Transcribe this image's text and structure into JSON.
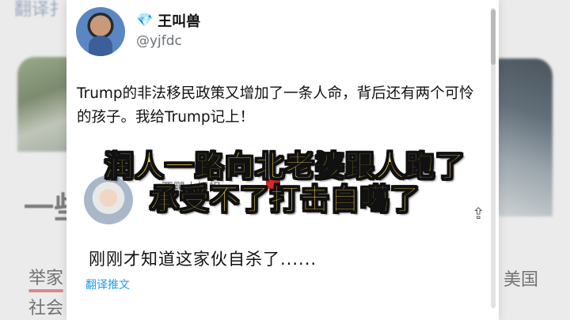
{
  "background": {
    "top_text": "翻译扌",
    "left_char": "一些",
    "bottom_left_1": "举家",
    "bottom_left_2": "社会",
    "bottom_right": "美国"
  },
  "tweet": {
    "display_name": "王叫兽",
    "handle": "@yjfdc",
    "text": "Trump的非法移民政策又增加了一条人命，背后还有两个可怜的孩子。我给Trump记上！"
  },
  "subtitles": {
    "line1": "润人一路向北老婆跟人跑了",
    "line2": "承受不了打击自噶了"
  },
  "reply": {
    "name": "西颶小姐姐",
    "text": "刚刚才知道这家伙自杀了......",
    "translate_label": "翻译推文"
  },
  "colors": {
    "link": "#1d9bf0",
    "subtitle_fill": "#f6d94a",
    "verified_diamond": "#2bb0f0"
  },
  "icons": {
    "diamond": "💎",
    "share": "⇪"
  }
}
